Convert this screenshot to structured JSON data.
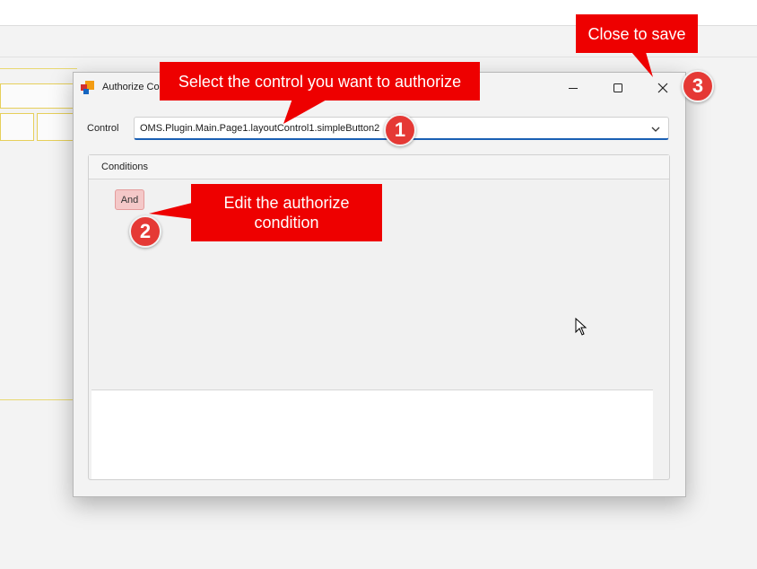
{
  "dialog": {
    "title": "Authorize Control",
    "control_label": "Control",
    "control_value": "OMS.Plugin.Main.Page1.layoutControl1.simpleButton2",
    "conditions_title": "Conditions",
    "and_label": "And"
  },
  "callouts": {
    "select_control": "Select the control you want to authorize",
    "edit_condition": "Edit the authorize condition",
    "close_to_save": "Close to save"
  },
  "badges": [
    "1",
    "2",
    "3"
  ],
  "colors": {
    "callout_red": "#ee0000",
    "badge_red": "#e53935",
    "accent_blue": "#1a5fb4",
    "and_button_bg": "#f4c8c8"
  },
  "icons": [
    "app-icon",
    "minimize-icon",
    "maximize-icon",
    "close-icon",
    "chevron-down-icon",
    "mouse-cursor-icon"
  ]
}
